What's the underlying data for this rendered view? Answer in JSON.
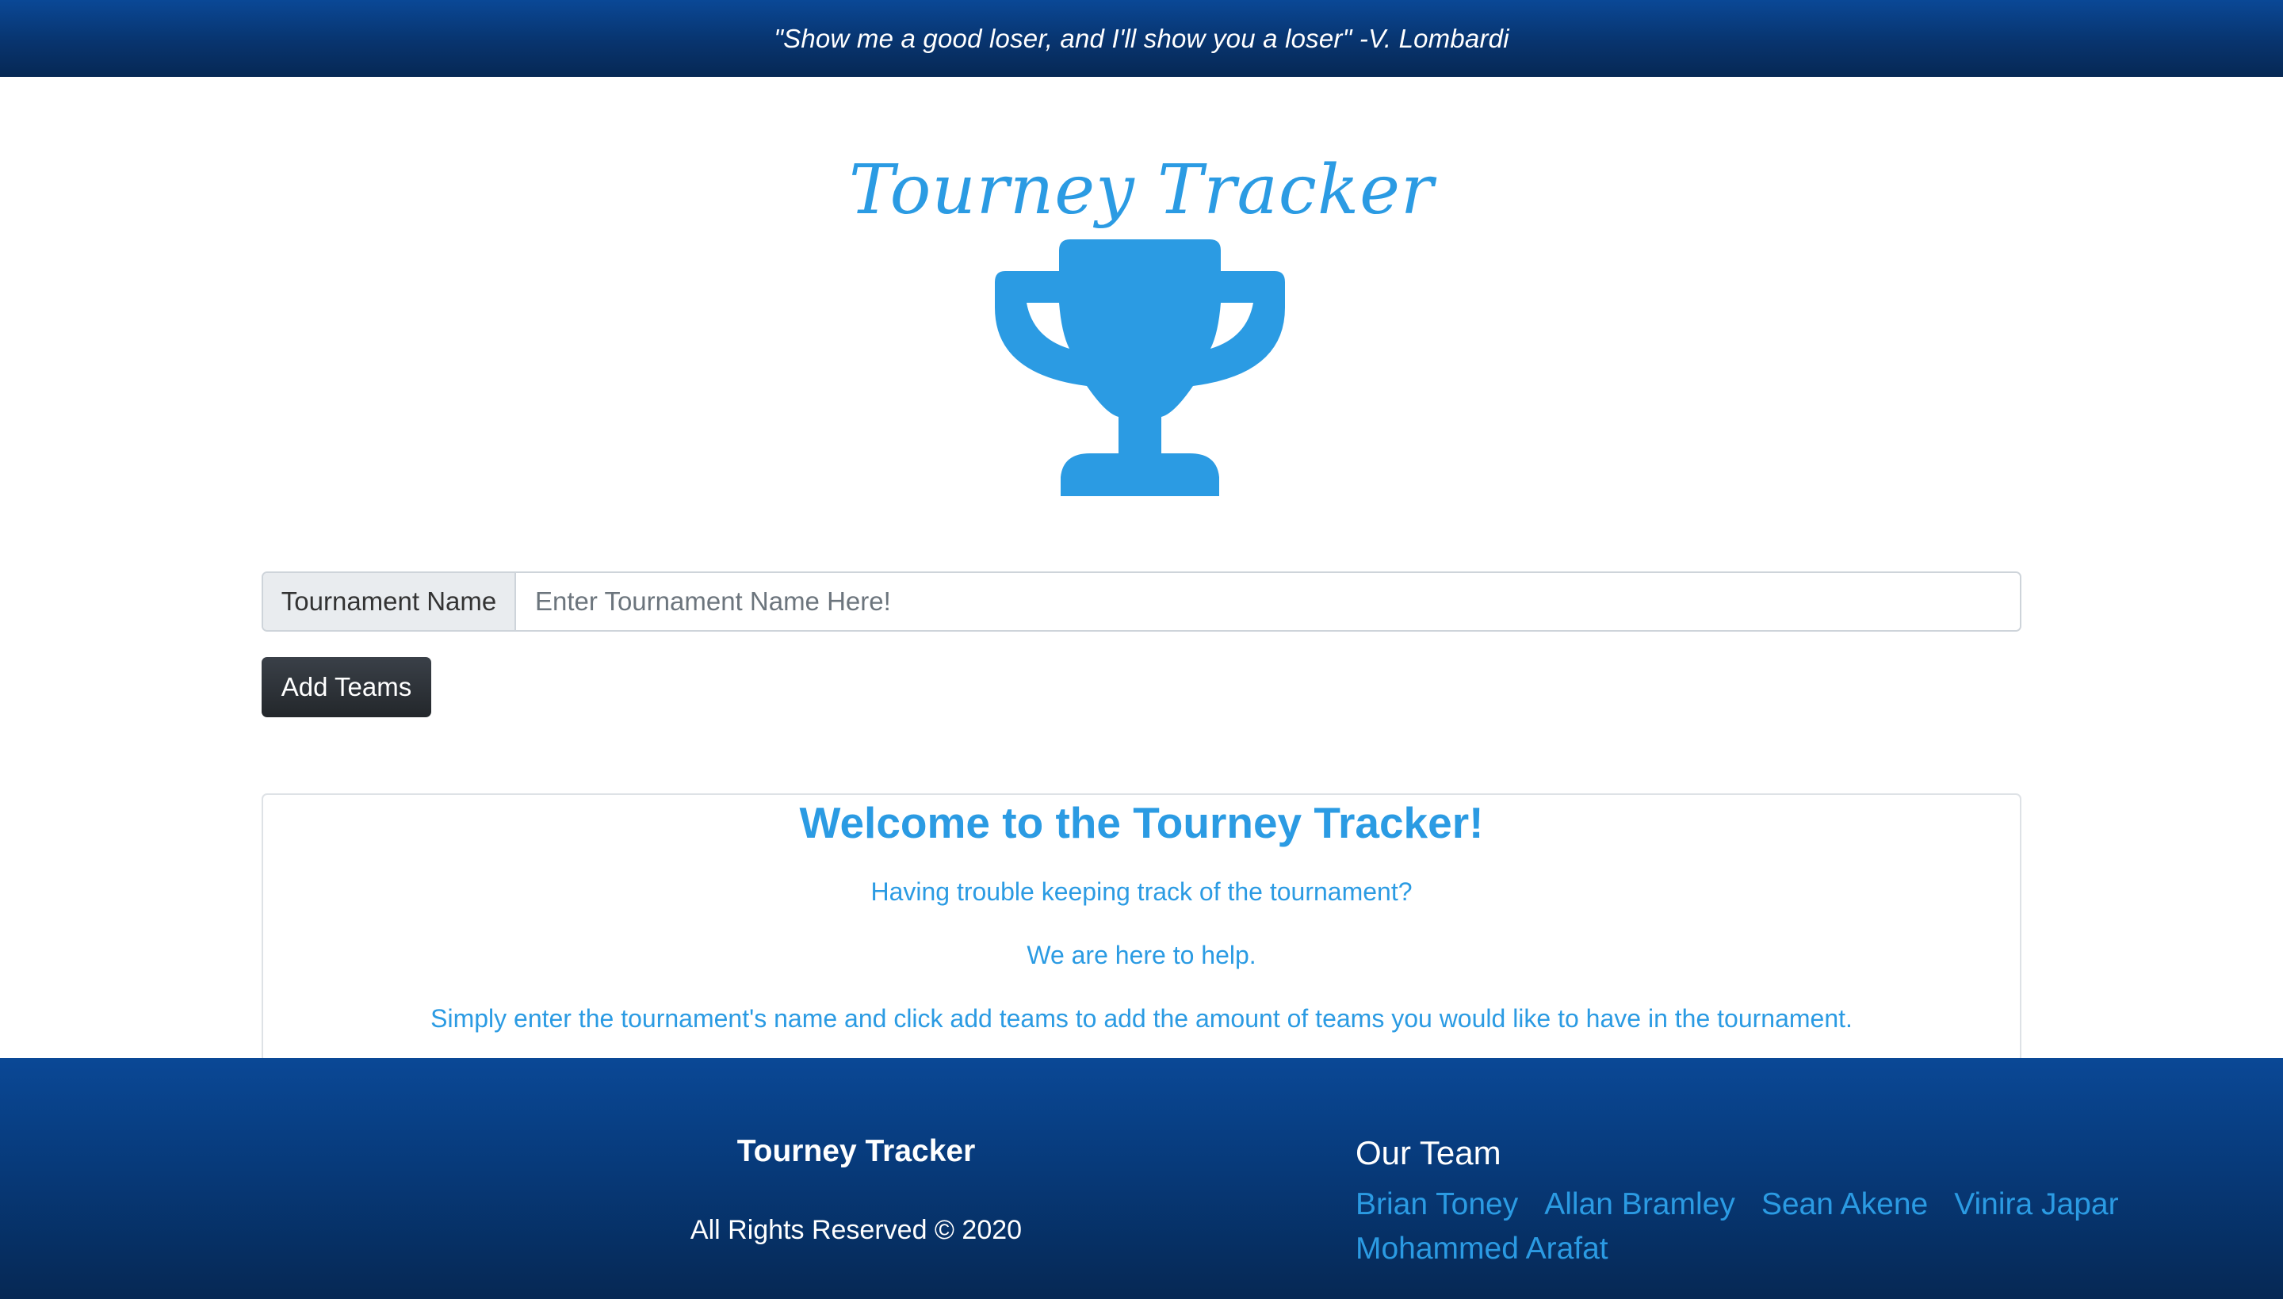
{
  "header": {
    "quote": "\"Show me a good loser, and I'll show you a loser\" -V. Lombardi"
  },
  "brand": {
    "title": "Tourney Tracker",
    "icon": "trophy-icon",
    "accent_color": "#2b9be3"
  },
  "form": {
    "label": "Tournament Name",
    "placeholder": "Enter Tournament Name Here!",
    "value": "",
    "button_label": "Add Teams"
  },
  "welcome": {
    "heading": "Welcome to the Tourney Tracker!",
    "lines": [
      "Having trouble keeping track of the tournament?",
      "We are here to help.",
      "Simply enter the tournament's name and click add teams to add the amount of teams you would like to have in the tournament."
    ]
  },
  "footer": {
    "brand": "Tourney Tracker",
    "rights": "All Rights Reserved © 2020",
    "team_title": "Our Team",
    "members": [
      "Brian Toney",
      "Allan Bramley",
      "Sean Akene",
      "Vinira Japar",
      "Mohammed Arafat"
    ]
  }
}
